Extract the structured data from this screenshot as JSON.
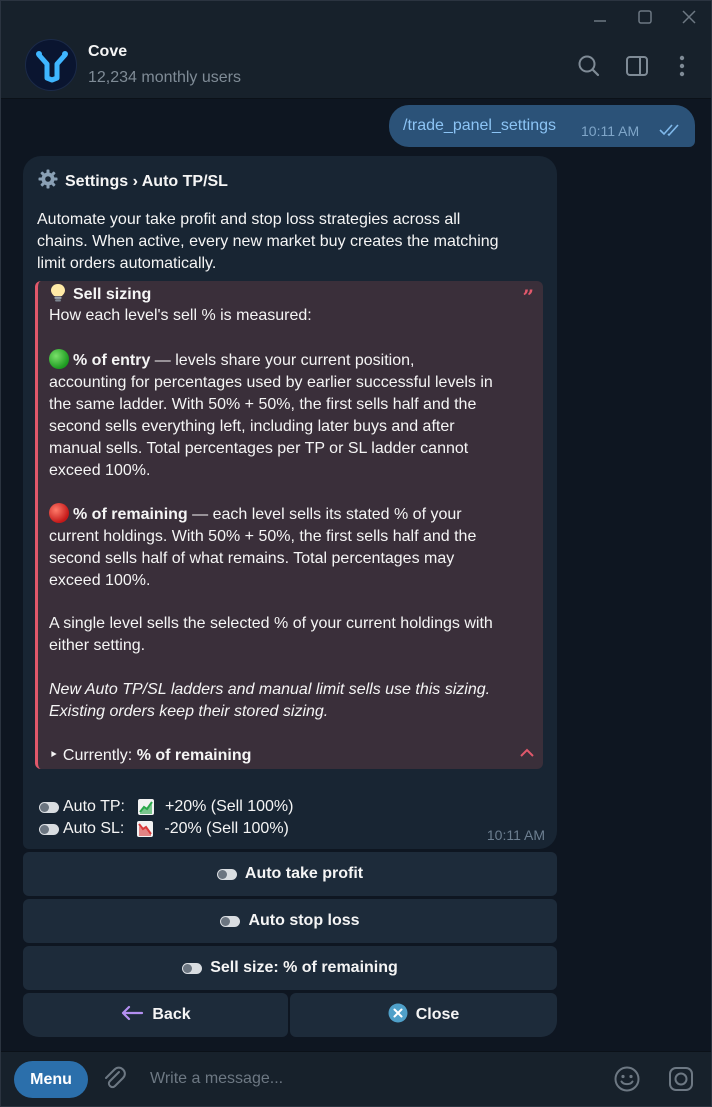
{
  "chat": {
    "title": "Cove",
    "subtitle": "12,234 monthly users"
  },
  "outgoing": {
    "text": "/trade_panel_settings",
    "time": "10:11 AM"
  },
  "incoming": {
    "title": "Settings › Auto TP/SL",
    "intro_lines": [
      "Automate your take profit and stop loss strategies across all",
      "chains. When active, every new market buy creates the matching",
      "limit orders automatically."
    ],
    "quote": {
      "heading": "Sell sizing",
      "subheading": "How each level's sell % is measured:",
      "entry_label": "% of entry",
      "entry_lines": [
        " — levels share your current position,",
        "accounting for percentages used by earlier successful levels in",
        "the same ladder. With 50% + 50%, the first sells half and the",
        "second sells everything left, including later buys and after",
        "manual sells. Total percentages per TP or SL ladder cannot",
        "exceed 100%."
      ],
      "remaining_label": "% of remaining",
      "remaining_lines": [
        " — each level sells its stated % of your",
        "current holdings. With 50% + 50%, the first sells half and the",
        "second sells half of what remains. Total percentages may",
        "exceed 100%."
      ],
      "single_lines": [
        "A single level sells the selected % of your current holdings with",
        "either setting."
      ],
      "italic_lines": [
        "New Auto TP/SL ladders and manual limit sells use this sizing.",
        "Existing orders keep their stored sizing."
      ],
      "current_prefix": "‣ Currently: ",
      "current_value": "% of remaining"
    },
    "auto_tp": {
      "label": "Auto TP:",
      "value": "+20% (Sell 100%)"
    },
    "auto_sl": {
      "label": "Auto SL:",
      "value": "-20% (Sell 100%)"
    },
    "time": "10:11 AM"
  },
  "keyboard": {
    "auto_take_profit": "Auto take profit",
    "auto_stop_loss": "Auto stop loss",
    "sell_size": "Sell size: % of remaining",
    "back": "Back",
    "close": "Close"
  },
  "composer": {
    "menu_label": "Menu",
    "placeholder": "Write a message..."
  },
  "colors": {
    "background": "#0e1621",
    "outgoing_bubble": "#2b5278",
    "incoming_bubble": "#182533",
    "quote_accent": "#e0586b",
    "menu_button": "#2b6fab"
  }
}
